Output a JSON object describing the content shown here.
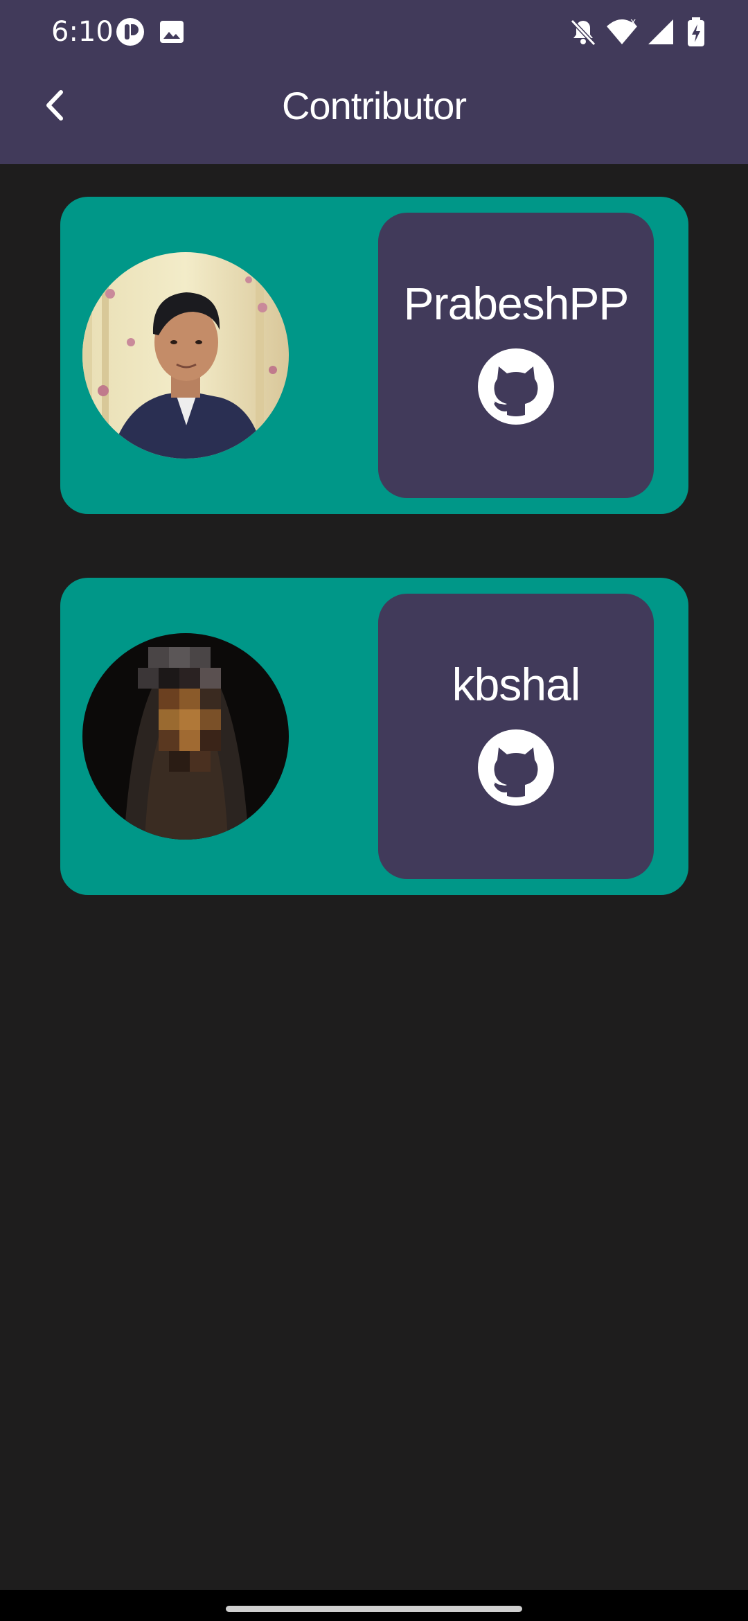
{
  "status_bar": {
    "time": "6:10",
    "left_icons": [
      "app-notification-icon",
      "image-notification-icon"
    ],
    "right_icons": [
      "bell-off-icon",
      "wifi-icon",
      "signal-icon",
      "battery-charging-icon"
    ]
  },
  "header": {
    "back_icon": "chevron-left-icon",
    "title": "Contributor"
  },
  "contributors": [
    {
      "username": "PrabeshPP",
      "link_icon": "github-icon"
    },
    {
      "username": "kbshal",
      "link_icon": "github-icon"
    }
  ],
  "colors": {
    "app_bar": "#413a5a",
    "background": "#1e1d1d",
    "card": "#009788",
    "panel": "#413a5a"
  }
}
